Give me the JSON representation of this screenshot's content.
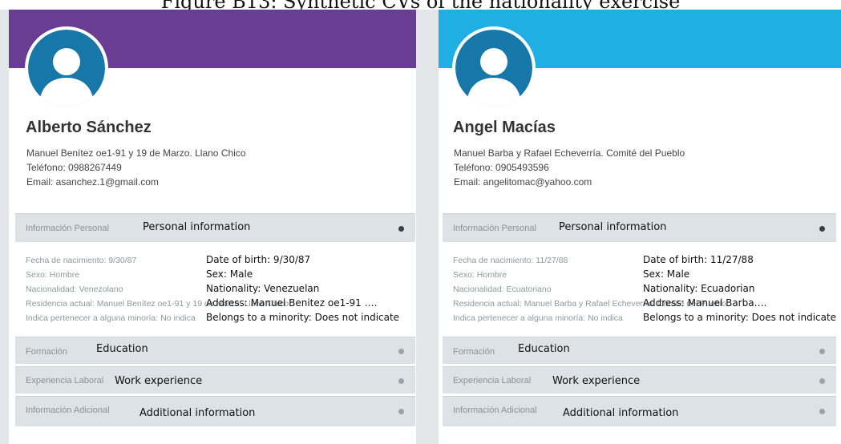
{
  "figure_title": "Figure B13:  Synthetic CVs of the nationality exercise",
  "colors": {
    "banner_left": "#693e92",
    "banner_right": "#1fafe3",
    "avatar_circle": "#1677a8"
  },
  "cards": [
    {
      "name": "Alberto Sánchez",
      "address": "Manuel Benítez oe1-91 y 19 de Marzo. Llano Chico",
      "phone": "Teléfono: 0988267449",
      "email": "Email: asanchez.1@gmail.com",
      "personal": {
        "label_es": "Información Personal",
        "label_en": "Personal information",
        "rows": [
          {
            "es": "Fecha de nacimiento: 9/30/87",
            "en": "Date of birth: 9/30/87"
          },
          {
            "es": "Sexo: Hombre",
            "en": "Sex: Male"
          },
          {
            "es": "Nacionalidad: Venezolano",
            "en": "Nationality: Venezuelan"
          },
          {
            "es": "Residencia actual: Manuel Benítez oe1-91 y 19 de Marzo. Llano Chico",
            "en": "Address: Manuel Benitez oe1-91 …."
          },
          {
            "es": "Indica pertenecer a alguna minoría: No indica",
            "en": "Belongs to a minority: Does not indicate"
          }
        ]
      },
      "education": {
        "label_es": "Formación",
        "label_en": "Education"
      },
      "work": {
        "label_es": "Experiencia Laboral",
        "label_en": "Work experience"
      },
      "additional": {
        "label_es": "Información Adicional",
        "label_en": "Additional information"
      }
    },
    {
      "name": "Angel Macías",
      "address": "Manuel Barba y Rafael Echeverría. Comité del Pueblo",
      "phone": "Teléfono: 0905493596",
      "email": "Email: angelitomac@yahoo.com",
      "personal": {
        "label_es": "Información Personal",
        "label_en": "Personal information",
        "rows": [
          {
            "es": "Fecha de nacimiento: 11/27/88",
            "en": "Date of birth: 11/27/88"
          },
          {
            "es": "Sexo: Hombre",
            "en": "Sex: Male"
          },
          {
            "es": "Nacionalidad: Ecuatoriano",
            "en": "Nationality: Ecuadorian"
          },
          {
            "es": "Residencia actual: Manuel Barba y Rafael Echeverría. Comité del Pueblo",
            "en": "Address: Manuel Barba…."
          },
          {
            "es": "Indica pertenecer a alguna minoría: No indica",
            "en": "Belongs to a minority: Does not indicate"
          }
        ]
      },
      "education": {
        "label_es": "Formación",
        "label_en": "Education"
      },
      "work": {
        "label_es": "Experiencia Laboral",
        "label_en": "Work experience"
      },
      "additional": {
        "label_es": "Información Adicional",
        "label_en": "Additional information"
      }
    }
  ]
}
